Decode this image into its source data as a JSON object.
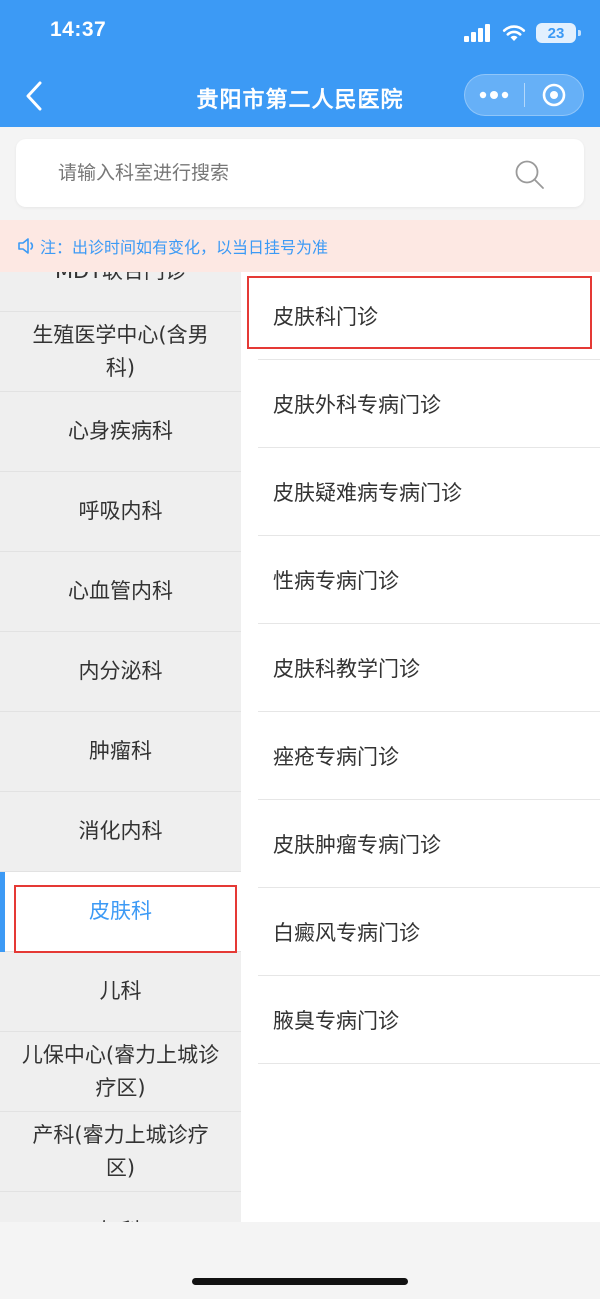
{
  "status_bar": {
    "time": "14:37",
    "battery": "23"
  },
  "header": {
    "title": "贵阳市第二人民医院"
  },
  "search": {
    "placeholder": "请输入科室进行搜索"
  },
  "notice": {
    "text": "注：出诊时间如有变化，以当日挂号为准"
  },
  "departments": [
    {
      "label": "MDT联合门诊"
    },
    {
      "label": "生殖医学中心(含男科)"
    },
    {
      "label": "心身疾病科"
    },
    {
      "label": "呼吸内科"
    },
    {
      "label": "心血管内科"
    },
    {
      "label": "内分泌科"
    },
    {
      "label": "肿瘤科"
    },
    {
      "label": "消化内科"
    },
    {
      "label": "皮肤科",
      "selected": true
    },
    {
      "label": "儿科"
    },
    {
      "label": "儿保中心(睿力上城诊疗区)"
    },
    {
      "label": "产科(睿力上城诊疗区)"
    },
    {
      "label": "妇科"
    }
  ],
  "clinics": [
    {
      "label": "皮肤科门诊"
    },
    {
      "label": "皮肤外科专病门诊"
    },
    {
      "label": "皮肤疑难病专病门诊"
    },
    {
      "label": "性病专病门诊"
    },
    {
      "label": "皮肤科教学门诊"
    },
    {
      "label": "痤疮专病门诊"
    },
    {
      "label": "皮肤肿瘤专病门诊"
    },
    {
      "label": "白癜风专病门诊"
    },
    {
      "label": "腋臭专病门诊"
    }
  ],
  "colors": {
    "accent": "#3c9af5",
    "notice_bg": "#fde8e3",
    "highlight": "#e53935"
  }
}
